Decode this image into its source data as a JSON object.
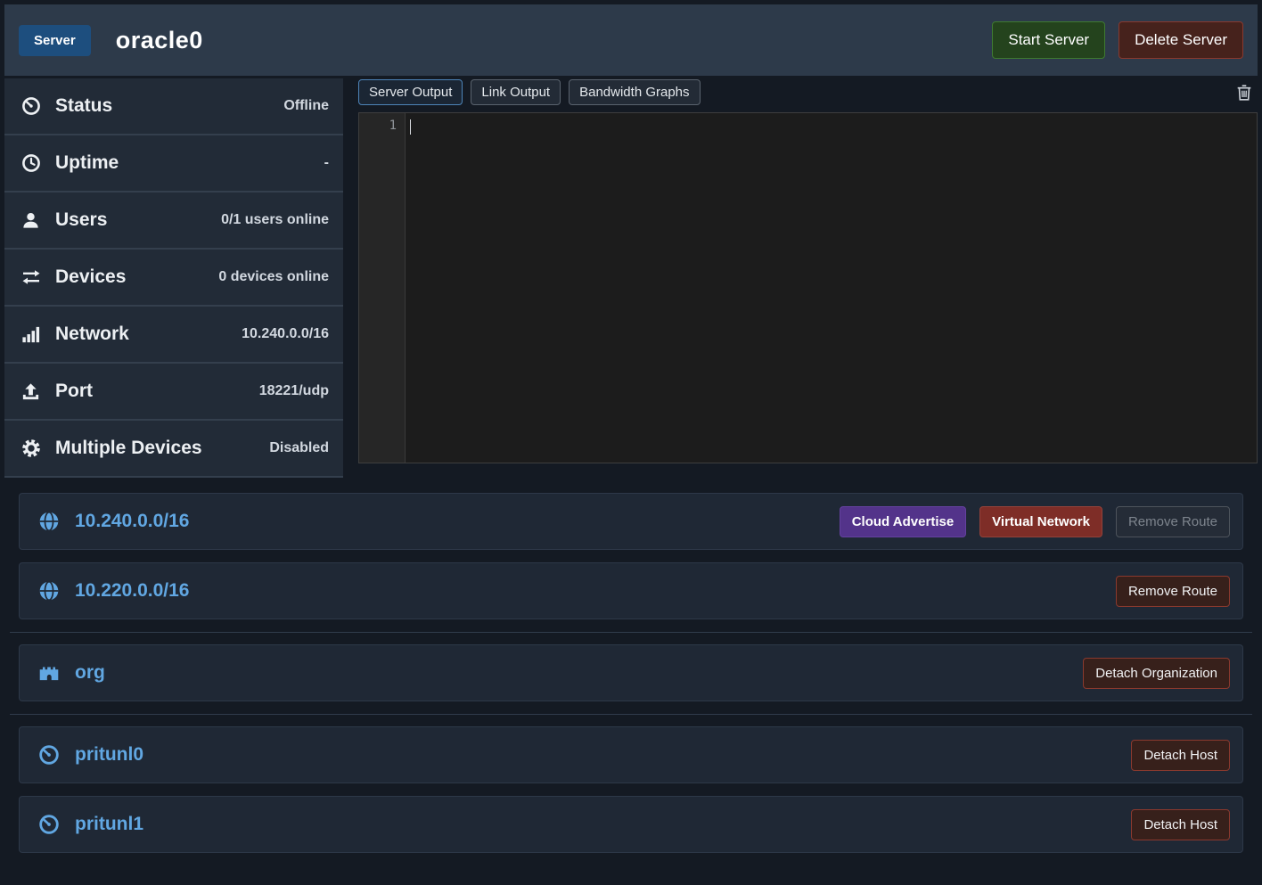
{
  "header": {
    "badge": "Server",
    "title": "oracle0",
    "start_button": "Start Server",
    "delete_button": "Delete Server"
  },
  "sidebar": {
    "items": [
      {
        "icon": "gauge-icon",
        "label": "Status",
        "value": "Offline"
      },
      {
        "icon": "clock-icon",
        "label": "Uptime",
        "value": "-"
      },
      {
        "icon": "user-icon",
        "label": "Users",
        "value": "0/1 users online"
      },
      {
        "icon": "exchange-icon",
        "label": "Devices",
        "value": "0 devices online"
      },
      {
        "icon": "signal-icon",
        "label": "Network",
        "value": "10.240.0.0/16"
      },
      {
        "icon": "upload-icon",
        "label": "Port",
        "value": "18221/udp"
      },
      {
        "icon": "gear-icon",
        "label": "Multiple Devices",
        "value": "Disabled"
      }
    ]
  },
  "output": {
    "tabs": [
      {
        "label": "Server Output",
        "active": true
      },
      {
        "label": "Link Output",
        "active": false
      },
      {
        "label": "Bandwidth Graphs",
        "active": false
      }
    ],
    "trash_icon": "trash-icon",
    "line_number": "1",
    "content": ""
  },
  "routes": [
    {
      "icon": "globe-icon",
      "address": "10.240.0.0/16",
      "buttons": [
        {
          "label": "Cloud Advertise",
          "style": "purple"
        },
        {
          "label": "Virtual Network",
          "style": "maroon"
        },
        {
          "label": "Remove Route",
          "style": "disabled"
        }
      ]
    },
    {
      "icon": "globe-icon",
      "address": "10.220.0.0/16",
      "buttons": [
        {
          "label": "Remove Route",
          "style": "danger"
        }
      ]
    }
  ],
  "organization": {
    "icon": "fort-icon",
    "name": "org",
    "detach_label": "Detach Organization"
  },
  "hosts": [
    {
      "icon": "gauge-icon",
      "name": "pritunl0",
      "detach_label": "Detach Host"
    },
    {
      "icon": "gauge-icon",
      "name": "pritunl1",
      "detach_label": "Detach Host"
    }
  ],
  "colors": {
    "accent_blue": "#61a7e2",
    "header_bg": "#2d3a4a",
    "green_border": "#3f7a30",
    "red_border": "#8a392e",
    "purple": "#53338a",
    "maroon": "#7e2d27"
  }
}
